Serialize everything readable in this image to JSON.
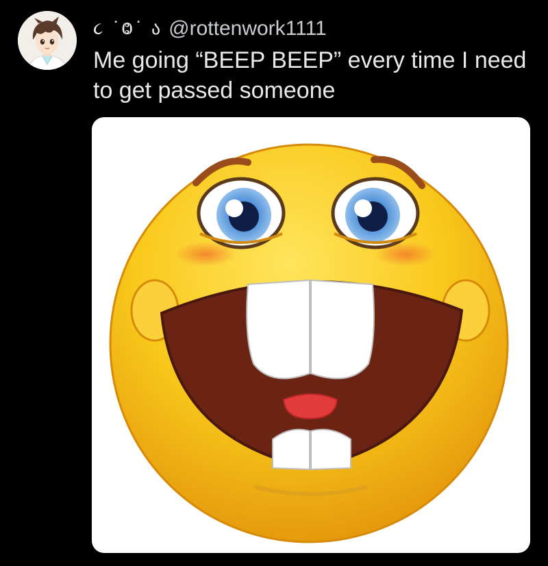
{
  "post": {
    "display_name": "૮ ˙Ⱉ˙ ა",
    "handle": "@rottenwork1111",
    "text": "Me going “BEEP BEEP” every time I need to get passed someone"
  },
  "avatar": {
    "icon": "anime-character-avatar"
  },
  "media": {
    "icon": "buck-teeth-smiley-emoji",
    "colors": {
      "face": "#f7c21a",
      "mouth": "#6b2414",
      "eye_iris": "#4f8fd8",
      "tongue": "#e23b3b"
    }
  }
}
